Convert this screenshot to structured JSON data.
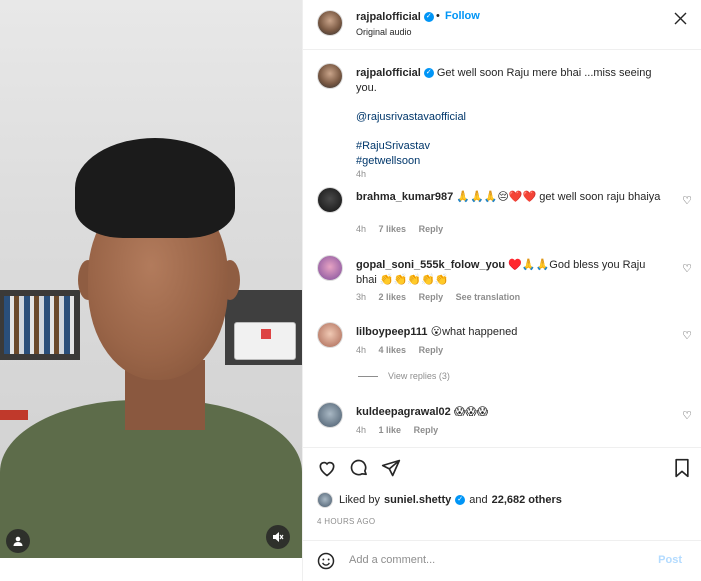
{
  "post": {
    "author": "rajpalofficial",
    "follow_label": "Follow",
    "dot": "•",
    "audio": "Original audio",
    "caption_text": "Get well soon Raju mere bhai ...miss seeing you.",
    "caption_mention": "@rajusrivastavaofficial",
    "caption_tag1": "#RajuSrivastav",
    "caption_tag2": "#getwellsoon",
    "caption_time": "4h"
  },
  "comments": [
    {
      "user": "brahma_kumar987",
      "text": "🙏🙏🙏😔❤️❤️ get well soon raju bhaiya",
      "time": "4h",
      "likes": "7 likes",
      "reply": "Reply"
    },
    {
      "user": "gopal_soni_555k_folow_you",
      "text": "♥️🙏🙏God bless you Raju bhai 👏👏👏👏👏",
      "time": "3h",
      "likes": "2 likes",
      "reply": "Reply",
      "translate": "See translation"
    },
    {
      "user": "lilboypeep111",
      "text": "😮what happened",
      "time": "4h",
      "likes": "4 likes",
      "reply": "Reply",
      "view_replies": "View replies (3)"
    },
    {
      "user": "kuldeepagrawal02",
      "text": "😱😱😱",
      "time": "4h",
      "likes": "1 like",
      "reply": "Reply"
    }
  ],
  "likes": {
    "prefix": "Liked by",
    "user": "suniel.shetty",
    "middle": "and",
    "others": "22,682 others"
  },
  "timestamp": "4 HOURS AGO",
  "composer": {
    "placeholder": "Add a comment...",
    "post_label": "Post"
  },
  "icons": {
    "close": "close-icon",
    "heart": "heart-icon",
    "comment": "comment-icon",
    "share": "share-icon",
    "save": "bookmark-icon",
    "emoji": "emoji-icon",
    "mute": "mute-icon",
    "user": "user-tag-icon"
  },
  "colors": {
    "accent": "#0095f6",
    "link": "#00376b",
    "muted": "#8e8e8e",
    "post_disabled": "#b3dbff"
  }
}
